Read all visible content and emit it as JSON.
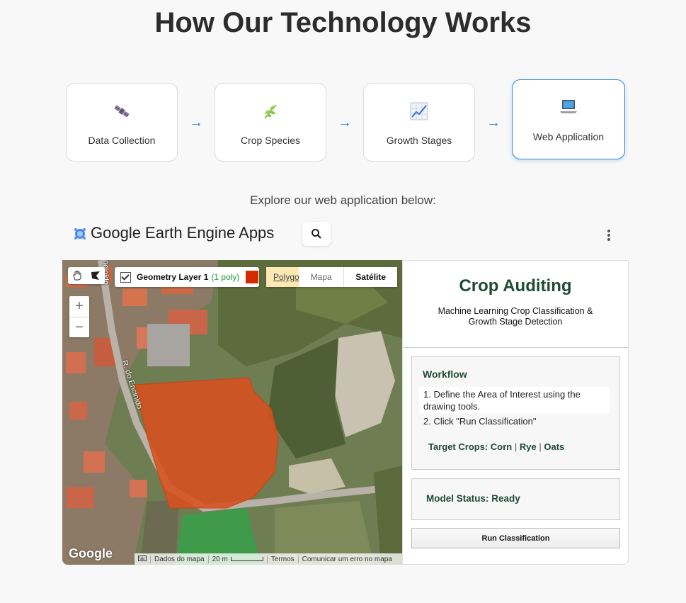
{
  "page": {
    "title": "How Our Technology Works",
    "explore_text": "Explore our web application below:"
  },
  "steps": [
    {
      "label": "Data Collection",
      "icon": "satellite-icon"
    },
    {
      "label": "Crop Species",
      "icon": "herb-icon"
    },
    {
      "label": "Growth Stages",
      "icon": "chart-increasing-icon"
    },
    {
      "label": "Web Application",
      "icon": "laptop-icon",
      "active": true
    }
  ],
  "arrow_glyph": "→",
  "gee": {
    "app_name": "Google Earth Engine Apps"
  },
  "map": {
    "geometry_layer_name": "Geometry Layer 1",
    "geometry_layer_count": "(1 poly)",
    "polygon_tab": "Polygo",
    "map_type_map": "Mapa",
    "map_type_satellite": "Satélite",
    "zoom_in": "+",
    "zoom_out": "−",
    "google_logo": "Google",
    "street_label": "R. do Encinido",
    "street_label_top": "ncinido",
    "attribution": {
      "map_data": "Dados do mapa",
      "scale": "20 m",
      "terms": "Termos",
      "report": "Comunicar um erro no mapa"
    },
    "colors": {
      "polygon": "#d42a00"
    }
  },
  "panel": {
    "title": "Crop Auditing",
    "subtitle_line1": "Machine Learning Crop Classification &",
    "subtitle_line2": "Growth Stage Detection",
    "workflow_heading": "Workflow",
    "step1": "1. Define the Area of Interest using the drawing tools.",
    "step2": "2. Click \"Run Classification\"",
    "target_label": "Target Crops:",
    "crops": [
      "Corn",
      "Rye",
      "Oats"
    ],
    "crop_sep": "|",
    "model_status": "Model Status: Ready",
    "run_button": "Run Classification",
    "colors": {
      "accent": "#1f4a35"
    }
  }
}
